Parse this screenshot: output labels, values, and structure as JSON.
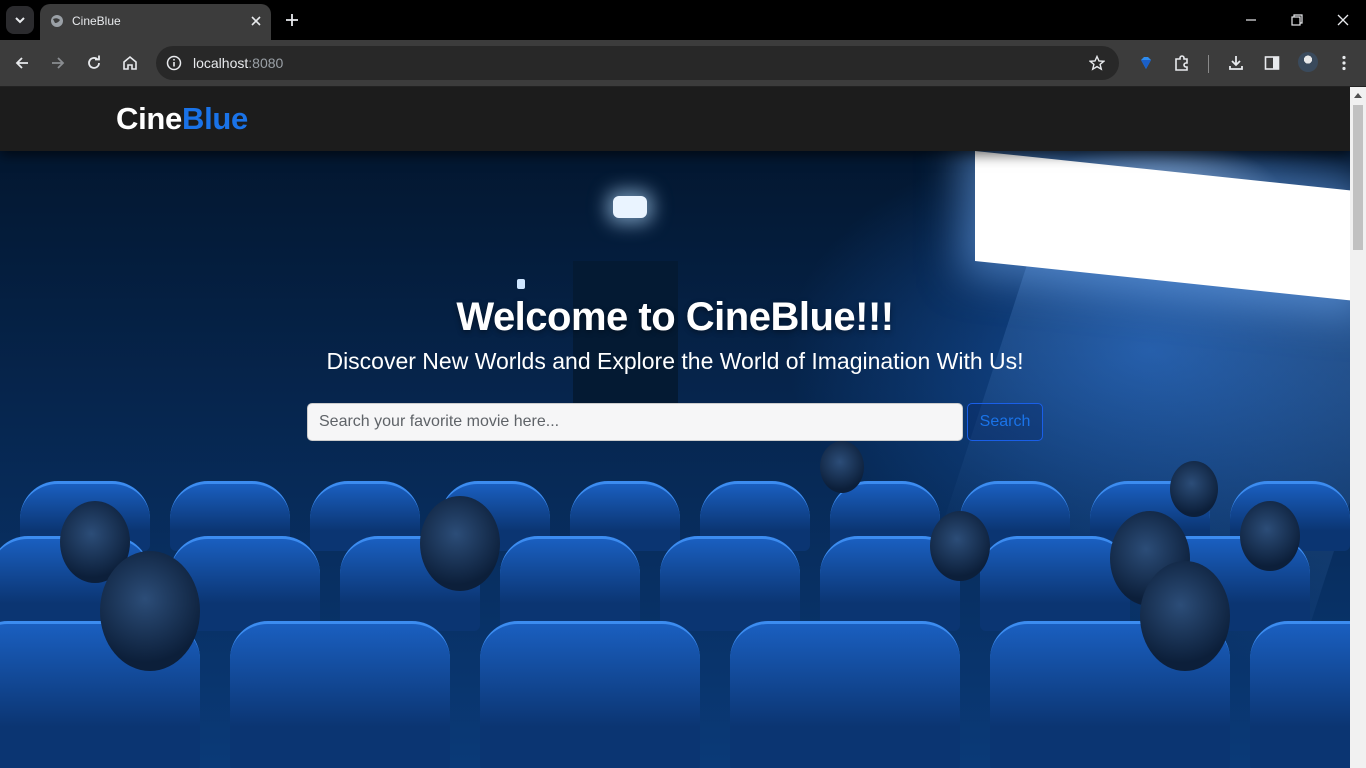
{
  "browser": {
    "tab_title": "CineBlue",
    "url_host": "localhost",
    "url_port": ":8080"
  },
  "site": {
    "brand_part1": "Cine",
    "brand_part2": "Blue",
    "brand_accent": "#1a73e8"
  },
  "hero": {
    "title": "Welcome to CineBlue!!!",
    "subtitle": "Discover New Worlds and Explore the World of Imagination With Us!",
    "search_placeholder": "Search your favorite movie here...",
    "search_button": "Search"
  },
  "icons": {
    "tab_menu": "chevron-down-icon",
    "favicon": "globe-icon",
    "tab_close": "close-icon",
    "new_tab": "plus-icon",
    "back": "back-arrow-icon",
    "forward": "forward-arrow-icon",
    "reload": "reload-icon",
    "home": "home-icon",
    "site_info": "info-icon",
    "bookmark": "star-icon",
    "extension_gem": "gem-icon",
    "extensions": "puzzle-icon",
    "downloads": "download-icon",
    "side_panel": "side-panel-icon",
    "profile": "avatar",
    "menu": "kebab-menu-icon"
  }
}
